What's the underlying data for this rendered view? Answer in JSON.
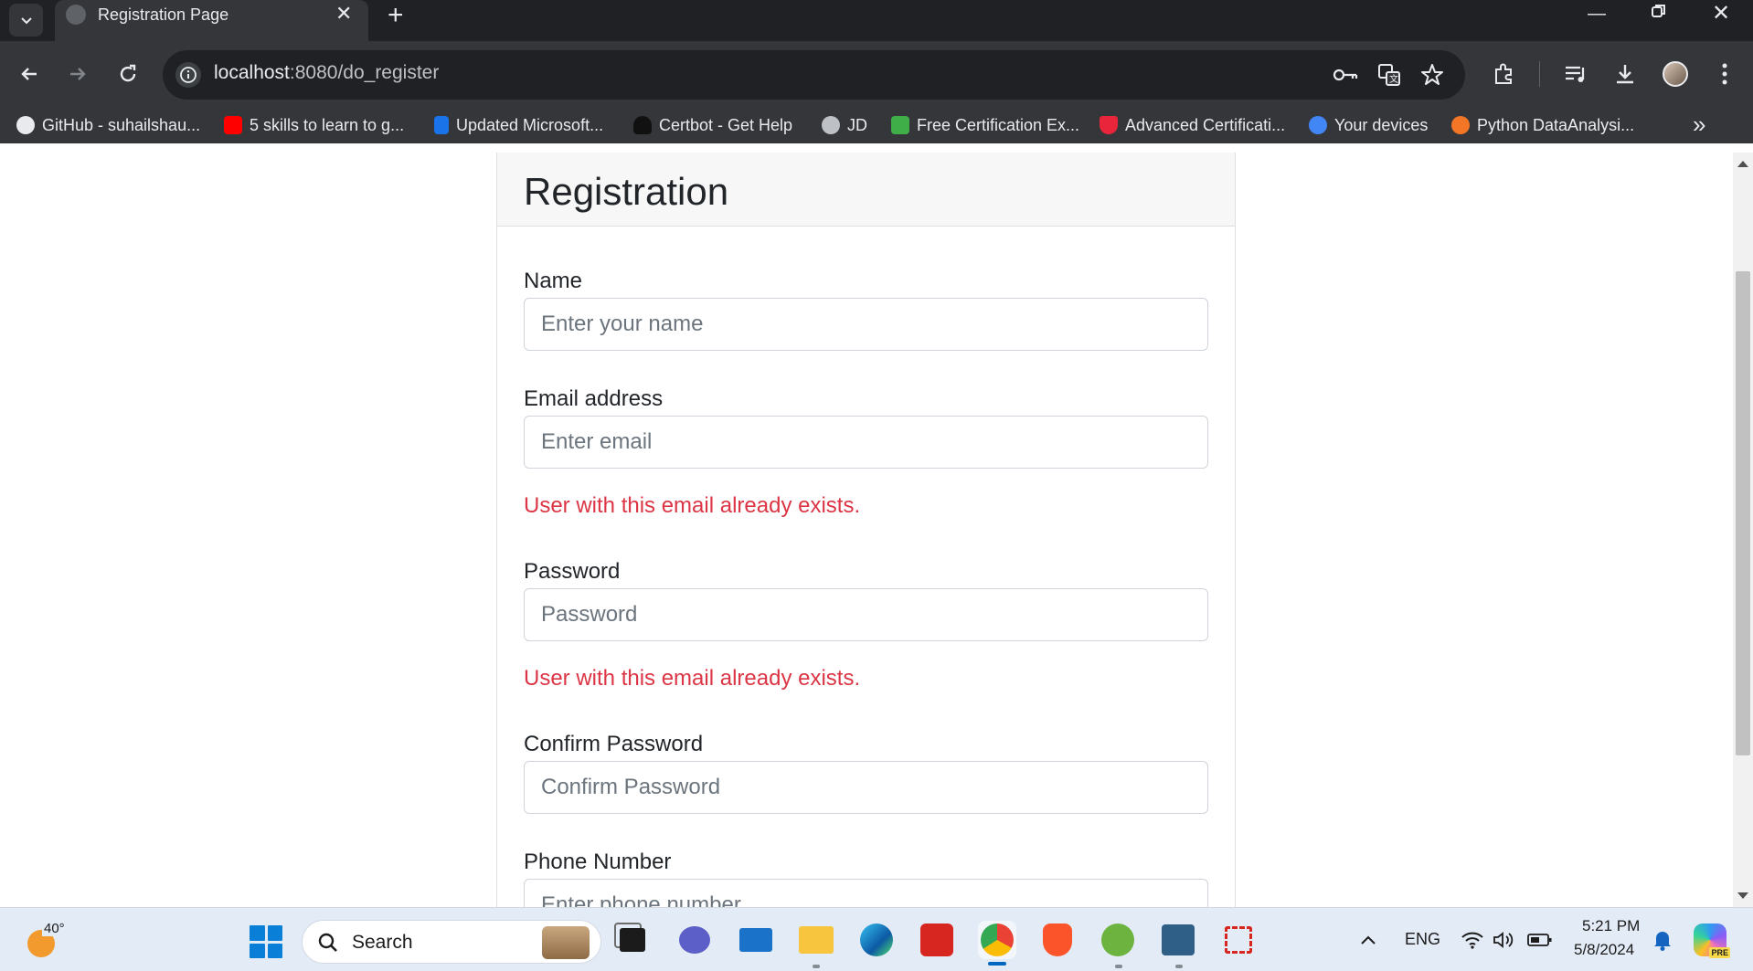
{
  "browser": {
    "tab_title": "Registration Page",
    "url_host": "localhost",
    "url_rest": ":8080/do_register",
    "bookmarks": [
      {
        "label": "GitHub - suhailshau...",
        "icon": "github-icon",
        "color": "#e8eaed"
      },
      {
        "label": "5 skills to learn to g...",
        "icon": "youtube-icon",
        "color": "#ff0000"
      },
      {
        "label": "Updated Microsoft...",
        "icon": "document-icon",
        "color": "#1a73e8"
      },
      {
        "label": "Certbot - Get Help",
        "icon": "certbot-icon",
        "color": "#111111"
      },
      {
        "label": "JD",
        "icon": "globe-icon",
        "color": "#bdc1c6"
      },
      {
        "label": "Free Certification Ex...",
        "icon": "pa-icon",
        "color": "#3fae49"
      },
      {
        "label": "Advanced Certificati...",
        "icon": "shield-icon",
        "color": "#e8253a"
      },
      {
        "label": "Your devices",
        "icon": "google-icon",
        "color": "#4285f4"
      },
      {
        "label": "Python DataAnalysi...",
        "icon": "jupyter-icon",
        "color": "#f37626"
      }
    ]
  },
  "form": {
    "title": "Registration",
    "name_label": "Name",
    "name_placeholder": "Enter your name",
    "email_label": "Email address",
    "email_placeholder": "Enter email",
    "email_error": "User with this email already exists.",
    "password_label": "Password",
    "password_placeholder": "Password",
    "password_error": "User with this email already exists.",
    "confirm_label": "Confirm Password",
    "confirm_placeholder": "Confirm Password",
    "phone_label": "Phone Number",
    "phone_placeholder": "Enter phone number"
  },
  "taskbar": {
    "weather_temp": "40°",
    "search_placeholder": "Search",
    "language": "ENG",
    "time": "5:21 PM",
    "date": "5/8/2024",
    "copilot_badge": "PRE"
  }
}
